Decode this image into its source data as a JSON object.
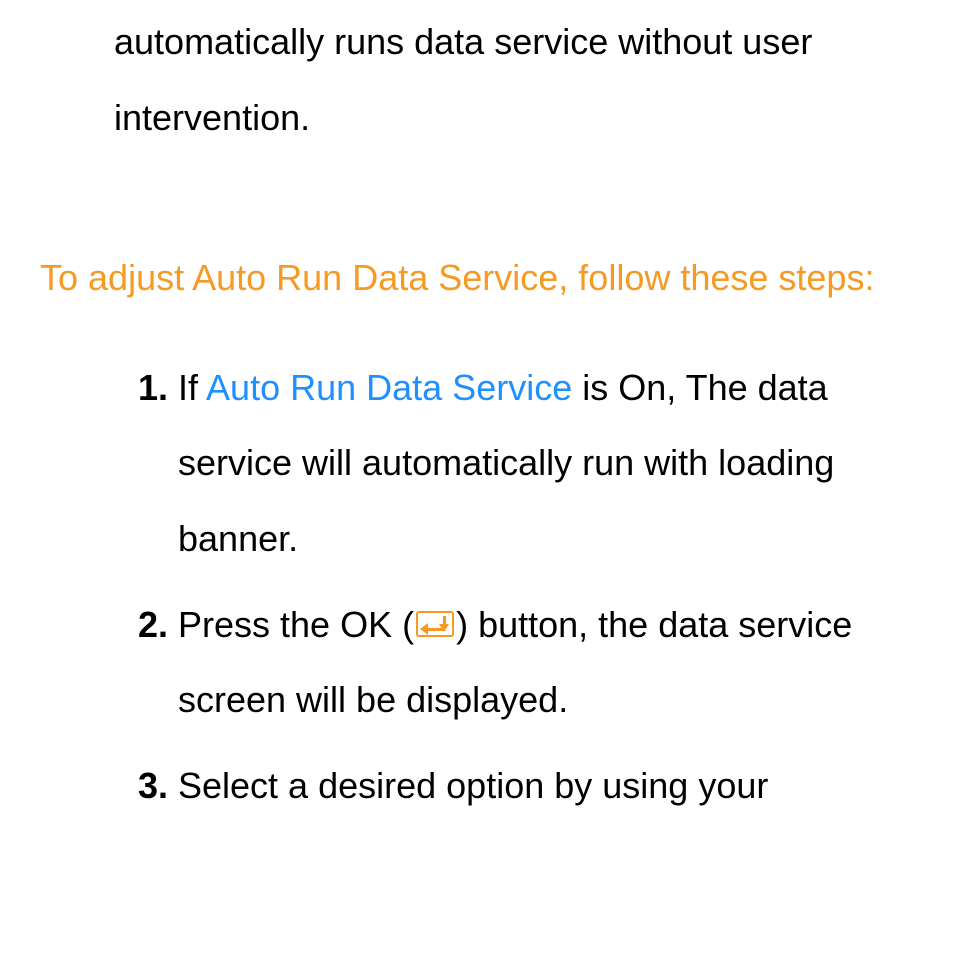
{
  "intro_fragment": "automatically runs data service without user intervention.",
  "heading": "To adjust Auto Run Data Service, follow these steps:",
  "steps": {
    "s1": {
      "num": "1.",
      "pre": "If ",
      "blue": "Auto Run Data Service",
      "post": " is On, The data service will automatically run with loading banner."
    },
    "s2": {
      "num": "2.",
      "pre": "Press the OK (",
      "post": ") button, the data service screen will be displayed."
    },
    "s3": {
      "num": "3.",
      "text": "Select a desired option by using your"
    }
  }
}
